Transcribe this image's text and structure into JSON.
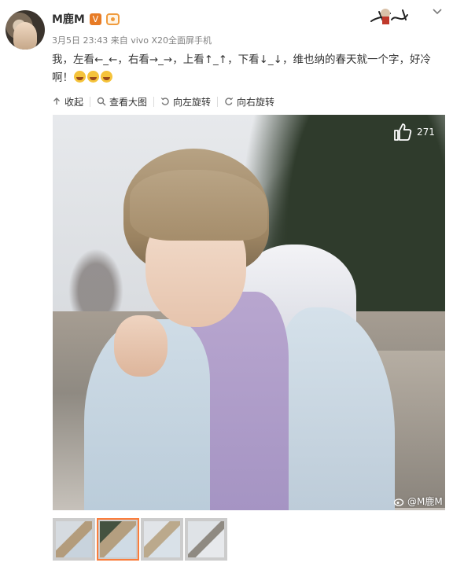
{
  "post": {
    "username": "M鹿M",
    "verified_badge": "V",
    "timestamp": "3月5日 23:43",
    "source": "来自 vivo X20全面屏手机",
    "text": "我，左看←_←，右看→_→，上看↑_↑，下看↓_↓，维也纳的春天就一个字，好冷啊！",
    "emoji_count": 3
  },
  "toolbar": {
    "collapse_label": "收起",
    "view_large_label": "查看大图",
    "rotate_left_label": "向左旋转",
    "rotate_right_label": "向右旋转"
  },
  "photo": {
    "like_count": "271",
    "watermark": "@M鹿M"
  },
  "thumbnails": {
    "count": 4,
    "active_index": 1
  },
  "colors": {
    "accent": "#fa7d3c",
    "verified": "#e77b25"
  }
}
